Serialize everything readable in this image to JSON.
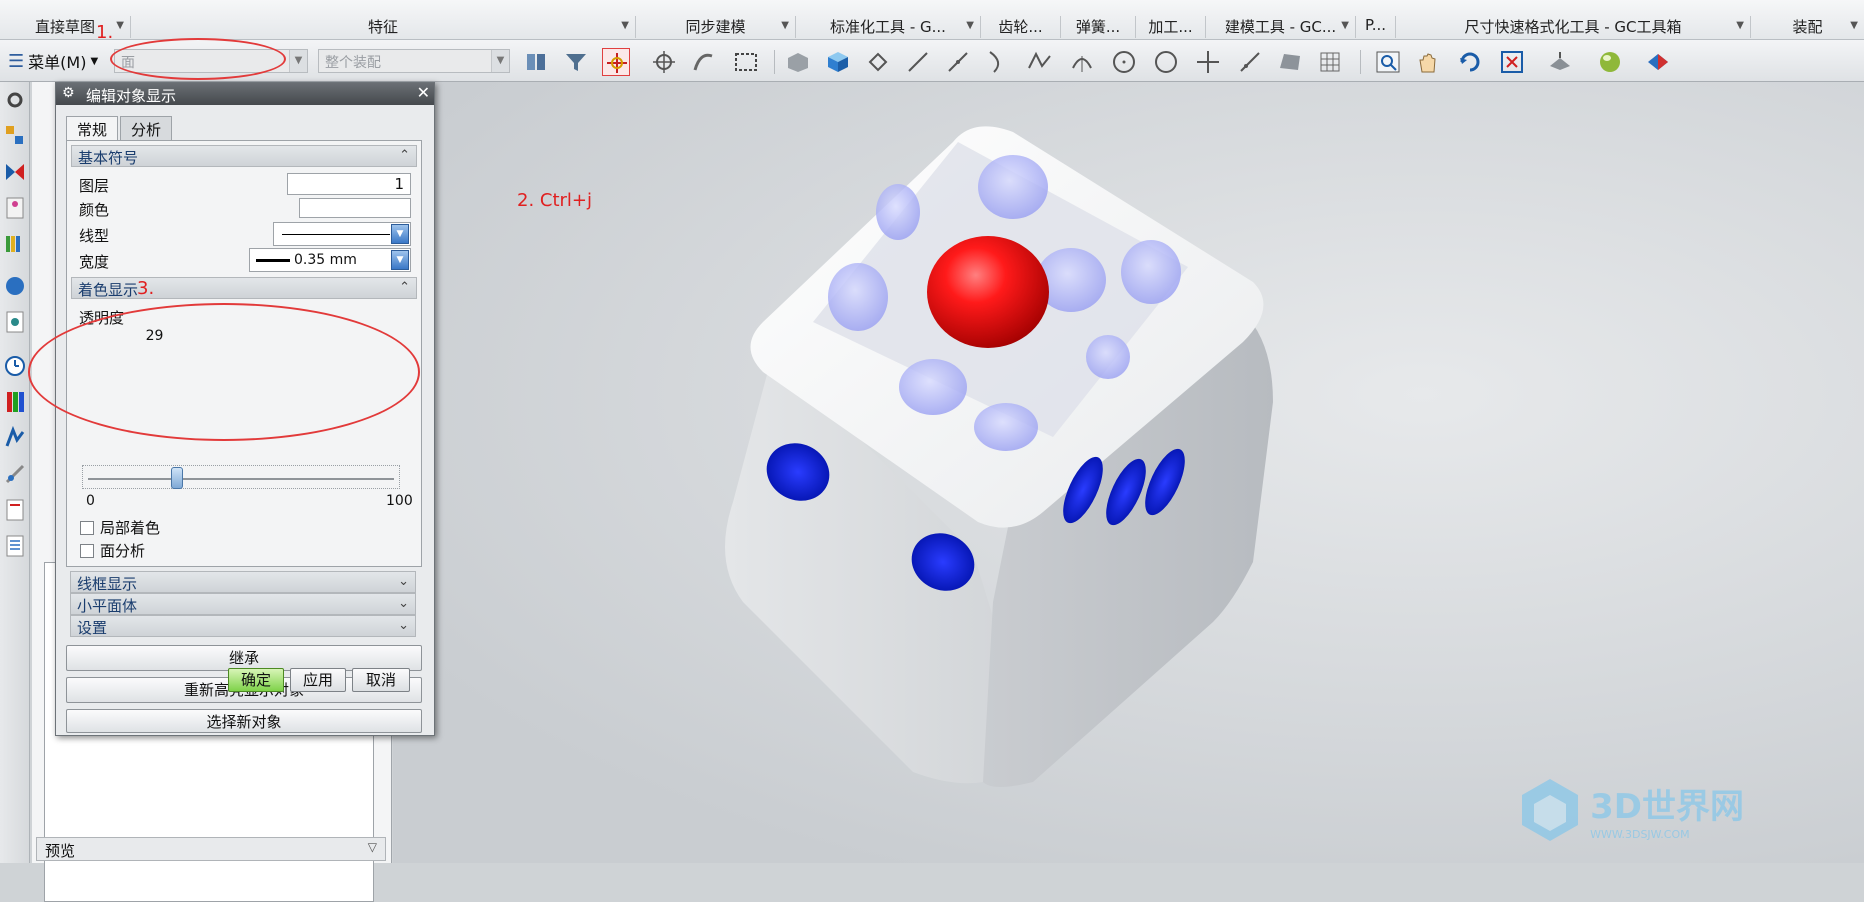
{
  "ribbon": {
    "groups": [
      {
        "label": "直接草图"
      },
      {
        "label": "特征"
      },
      {
        "label": "同步建模"
      },
      {
        "label": "标准化工具 - G..."
      },
      {
        "label": "齿轮..."
      },
      {
        "label": "弹簧..."
      },
      {
        "label": "加工..."
      },
      {
        "label": "建模工具 - GC..."
      },
      {
        "label": "P..."
      },
      {
        "label": "尺寸快速格式化工具 - GC工具箱"
      },
      {
        "label": "装配"
      }
    ]
  },
  "toolbar": {
    "menu_label": "菜单(M)",
    "selection_filter": "面",
    "selection_scope": "整个装配"
  },
  "navigator": {
    "preview_label": "预览"
  },
  "dialog": {
    "title": "编辑对象显示",
    "tabs": [
      {
        "label": "常规"
      },
      {
        "label": "分析"
      }
    ],
    "sections": {
      "basic": "基本符号",
      "shading": "着色显示",
      "wireframe": "线框显示",
      "facet": "小平面体",
      "settings": "设置"
    },
    "fields": {
      "layer_label": "图层",
      "layer_value": "1",
      "color_label": "颜色",
      "linetype_label": "线型",
      "width_label": "宽度",
      "width_value": "0.35 mm",
      "transparency_label": "透明度",
      "transparency_value": "29",
      "slider_min": "0",
      "slider_max": "100",
      "partial_shading": "局部着色",
      "face_analysis": "面分析"
    },
    "buttons": {
      "inherit": "继承",
      "rehighlight": "重新高亮显示对象",
      "select_new": "选择新对象",
      "ok": "确定",
      "apply": "应用",
      "cancel": "取消"
    }
  },
  "slider": {
    "value": 29,
    "min": 0,
    "max": 100
  },
  "annotations": {
    "step1": "1.",
    "step2": "2. Ctrl+j",
    "step3": "3."
  },
  "watermark": {
    "text": "3D世界网",
    "sub": "WWW.3DSJW.COM"
  },
  "colors": {
    "accent": "#3a78c7",
    "annotation": "#e02020",
    "ok_button": "#7fd24a",
    "die_pip_active": "#ff1a1a",
    "die_pip": "#0a1ee0"
  }
}
